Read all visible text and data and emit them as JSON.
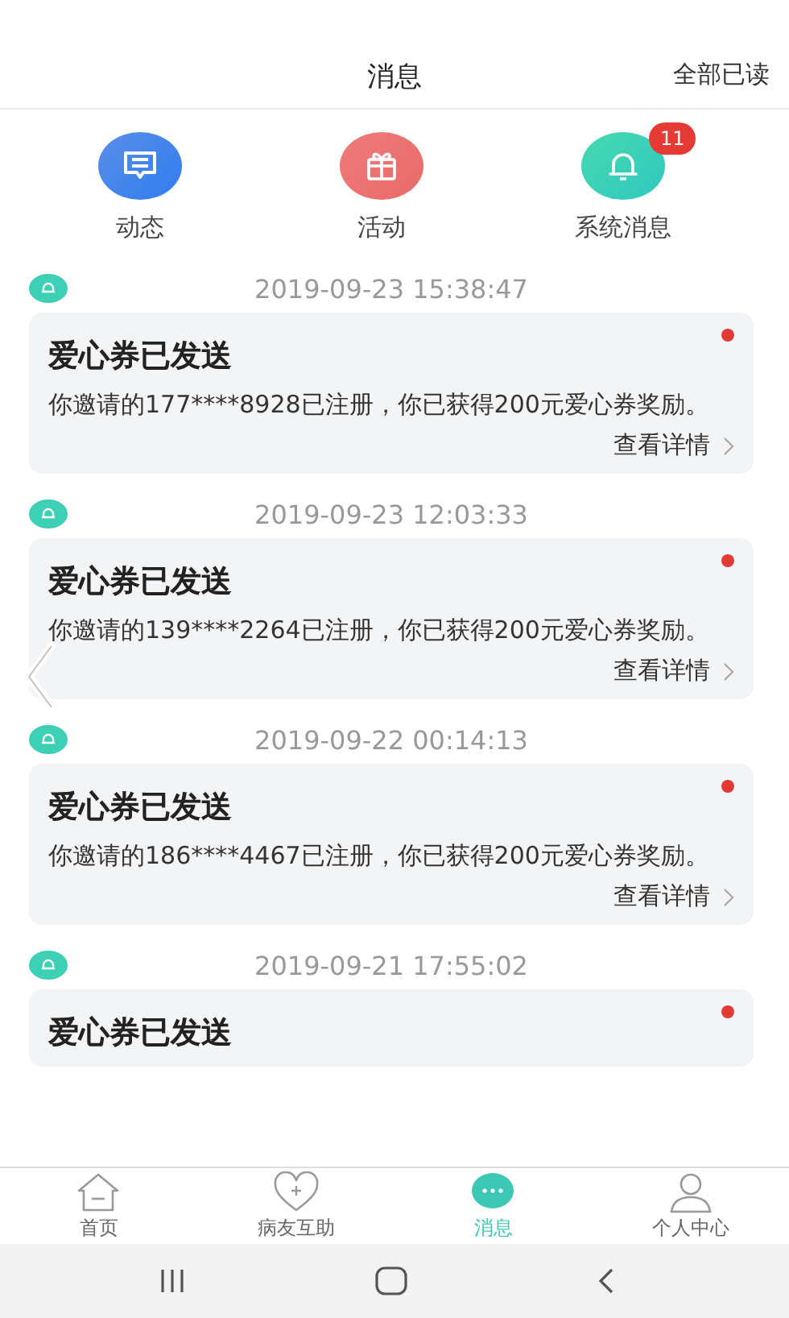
{
  "header": {
    "title": "消息",
    "action": "全部已读"
  },
  "categories": [
    {
      "label": "动态",
      "kind": "chat"
    },
    {
      "label": "活动",
      "kind": "gift"
    },
    {
      "label": "系统消息",
      "kind": "bell",
      "badge": "11"
    }
  ],
  "messages": [
    {
      "time": "2019-09-23 15:38:47",
      "title": "爱心券已发送",
      "body": "你邀请的177****8928已注册，你已获得200元爱心券奖励。",
      "link": "查看详情",
      "unread": true
    },
    {
      "time": "2019-09-23 12:03:33",
      "title": "爱心券已发送",
      "body": "你邀请的139****2264已注册，你已获得200元爱心券奖励。",
      "link": "查看详情",
      "unread": true
    },
    {
      "time": "2019-09-22 00:14:13",
      "title": "爱心券已发送",
      "body": "你邀请的186****4467已注册，你已获得200元爱心券奖励。",
      "link": "查看详情",
      "unread": true
    },
    {
      "time": "2019-09-21 17:55:02",
      "title": "爱心券已发送",
      "unread": true
    }
  ],
  "tabs": [
    {
      "label": "首页",
      "kind": "home",
      "selected": false
    },
    {
      "label": "病友互助",
      "kind": "heart",
      "selected": false
    },
    {
      "label": "消息",
      "kind": "chat",
      "selected": true
    },
    {
      "label": "个人中心",
      "kind": "person",
      "selected": false
    }
  ]
}
